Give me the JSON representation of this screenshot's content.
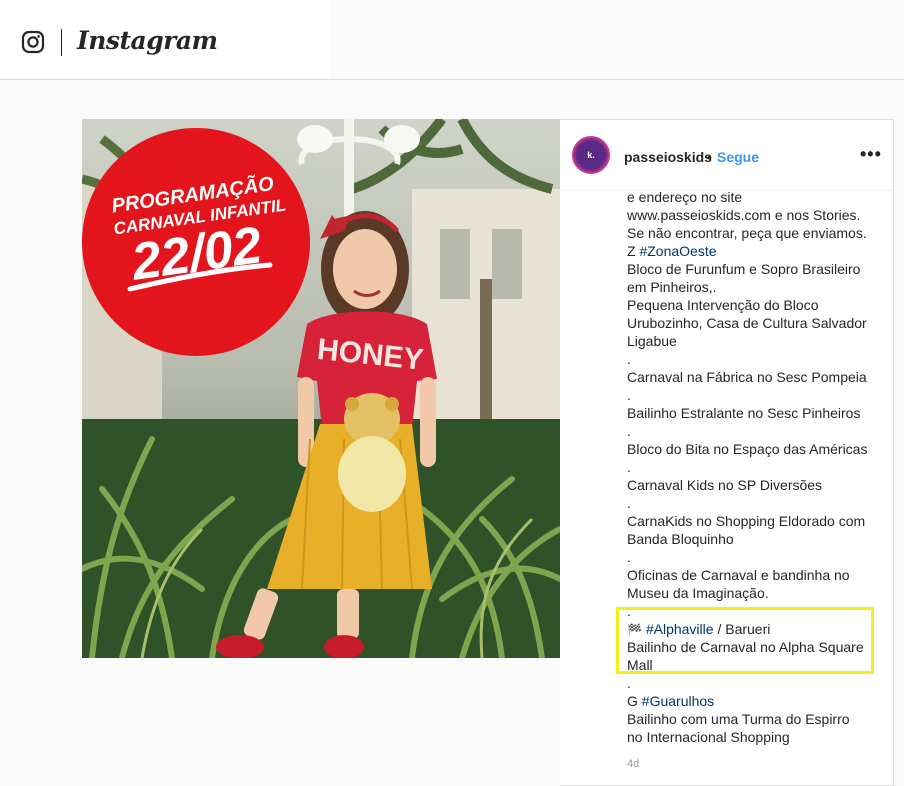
{
  "header": {
    "brand": "Instagram"
  },
  "post": {
    "image": {
      "badge_line1": "PROGRAMAÇÃO",
      "badge_line2": "CARNAVAL INFANTIL",
      "badge_date": "22/02",
      "shirt_text": "HONEY"
    },
    "author": {
      "avatar_text": "k.",
      "username": "passeioskids",
      "separator": "•",
      "follow_label": "Segue",
      "more_icon": "•••"
    },
    "caption": {
      "l01": "e endereço no site",
      "l02": "www.passeioskids.com e nos Stories.",
      "l03": "Se não encontrar, peça que enviamos.",
      "l04_prefix": "Z ",
      "l04_tag": "#ZonaOeste",
      "l05": "Bloco de Furunfum e Sopro Brasileiro",
      "l06": "em Pinheiros,.",
      "l07": "Pequena Intervenção do Bloco",
      "l08": "Urubozinho, Casa de Cultura Salvador",
      "l09": "Ligabue",
      "l10": ".",
      "l11": "Carnaval na Fábrica no Sesc Pompeia",
      "l12": ".",
      "l13": "Bailinho Estralante no Sesc Pinheiros",
      "l14": ".",
      "l15": "Bloco do Bita no Espaço das Américas",
      "l16": ".",
      "l17": "Carnaval Kids no SP Diversões",
      "l18": ".",
      "l19": "CarnaKids no Shopping Eldorado com",
      "l20": "Banda Bloquinho",
      "l21": ".",
      "l22": "Oficinas de Carnaval e bandinha no",
      "l23": "Museu da Imaginação.",
      "l24": ".",
      "l25_emoji": "🏁",
      "l25_tag": "#Alphaville",
      "l25_suffix": " / Barueri",
      "l26": "Bailinho de Carnaval no Alpha Square",
      "l27": "Mall",
      "l28": ".",
      "l29_prefix": "G ",
      "l29_tag": "#Guarulhos",
      "l30": "Bailinho com uma Turma do Espirro",
      "l31": "no Internacional Shopping"
    },
    "timestamp": "4d"
  },
  "colors": {
    "accent_blue": "#3897f0",
    "hashtag": "#003569",
    "highlight": "#f5ee1b",
    "badge_red": "#e3141b"
  }
}
